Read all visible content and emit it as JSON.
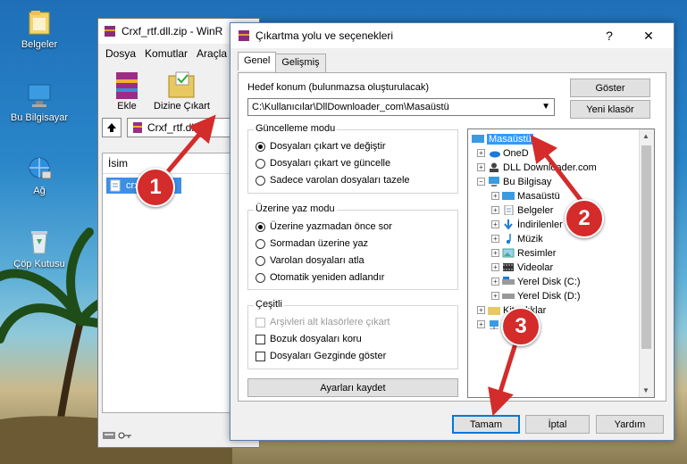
{
  "desktop": {
    "icons": [
      {
        "label": "Belgeler"
      },
      {
        "label": "Bu Bilgisayar"
      },
      {
        "label": "Ağ"
      },
      {
        "label": "Çöp Kutusu"
      }
    ]
  },
  "winrar": {
    "title": "Crxf_rtf.dll.zip - WinR",
    "menu": [
      "Dosya",
      "Komutlar",
      "Araçla"
    ],
    "tools": {
      "add": "Ekle",
      "extract_to": "Dizine Çıkart"
    },
    "path": "Crxf_rtf.dll.zi",
    "column_name": "İsim",
    "row_file": "crx"
  },
  "dialog": {
    "title": "Çıkartma yolu ve seçenekleri",
    "help": "?",
    "close": "✕",
    "tabs": [
      "Genel",
      "Gelişmiş"
    ],
    "dest_label": "Hedef konum (bulunmazsa oluşturulacak)",
    "dest_value": "C:\\Kullanıcılar\\DllDownloader_com\\Masaüstü",
    "show_button": "Göster",
    "new_folder_button": "Yeni klasör",
    "update_mode": {
      "title": "Güncelleme modu",
      "options": [
        "Dosyaları çıkart ve değiştir",
        "Dosyaları çıkart ve güncelle",
        "Sadece varolan dosyaları tazele"
      ]
    },
    "overwrite_mode": {
      "title": "Üzerine yaz modu",
      "options": [
        "Üzerine yazmadan önce sor",
        "Sormadan üzerine yaz",
        "Varolan dosyaları atla",
        "Otomatik yeniden adlandır"
      ]
    },
    "misc": {
      "title": "Çeşitli",
      "options": [
        "Arşivleri alt klasörlere çıkart",
        "Bozuk dosyaları koru",
        "Dosyaları Gezginde göster"
      ]
    },
    "save_settings": "Ayarları kaydet",
    "tree": [
      "Masaüstü",
      "OneD",
      "DLL Downloader.com",
      "Bu Bilgisay",
      "Masaüstü",
      "Belgeler",
      "İndirilenler",
      "Müzik",
      "Resimler",
      "Videolar",
      "Yerel Disk (C:)",
      "Yerel Disk (D:)",
      "Kitaplıklar"
    ],
    "ok": "Tamam",
    "cancel": "İptal",
    "help_button": "Yardım"
  },
  "badges": [
    "1",
    "2",
    "3"
  ],
  "colors": {
    "accent": "#0078d7",
    "selection": "#3399ff",
    "badge": "#d42b2b"
  }
}
